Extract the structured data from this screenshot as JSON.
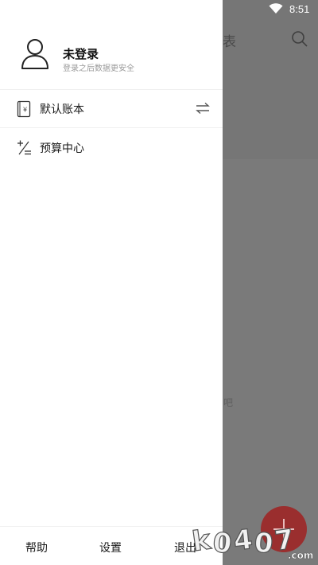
{
  "status_bar": {
    "time": "8:51",
    "wifi_icon": "wifi-icon"
  },
  "background": {
    "title_partial": "表",
    "hint_partial": "吧",
    "search_icon": "search-icon",
    "fab_icon": "plus-icon",
    "accent": "#9a2e2e"
  },
  "drawer": {
    "profile": {
      "name": "未登录",
      "subtitle": "登录之后数据更安全",
      "avatar_icon": "person-icon"
    },
    "menu": [
      {
        "label": "默认账本",
        "icon": "ledger-book-icon",
        "action_icon": "switch-arrows-icon"
      },
      {
        "label": "预算中心",
        "icon": "plus-minus-icon"
      }
    ],
    "bottom": {
      "help": "帮助",
      "settings": "设置",
      "logout": "退出"
    }
  },
  "watermark": {
    "text": "k0407.com"
  }
}
